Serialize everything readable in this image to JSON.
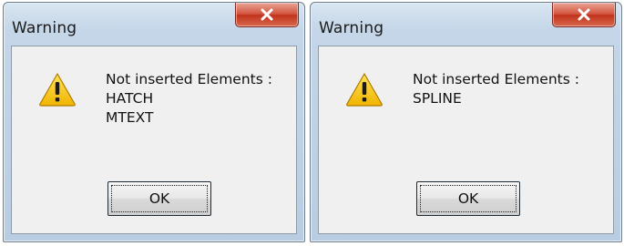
{
  "dialogs": [
    {
      "title": "Warning",
      "close_icon": "close-icon",
      "icon": "warning-icon",
      "message_lines": [
        "Not inserted Elements :",
        "HATCH",
        "MTEXT"
      ],
      "ok_label": "OK"
    },
    {
      "title": "Warning",
      "close_icon": "close-icon",
      "icon": "warning-icon",
      "message_lines": [
        "Not inserted Elements :",
        "SPLINE"
      ],
      "ok_label": "OK"
    }
  ],
  "colors": {
    "close_button": "#c8422b",
    "warning_fill": "#f5c400",
    "client_background": "#f0f0f0"
  }
}
